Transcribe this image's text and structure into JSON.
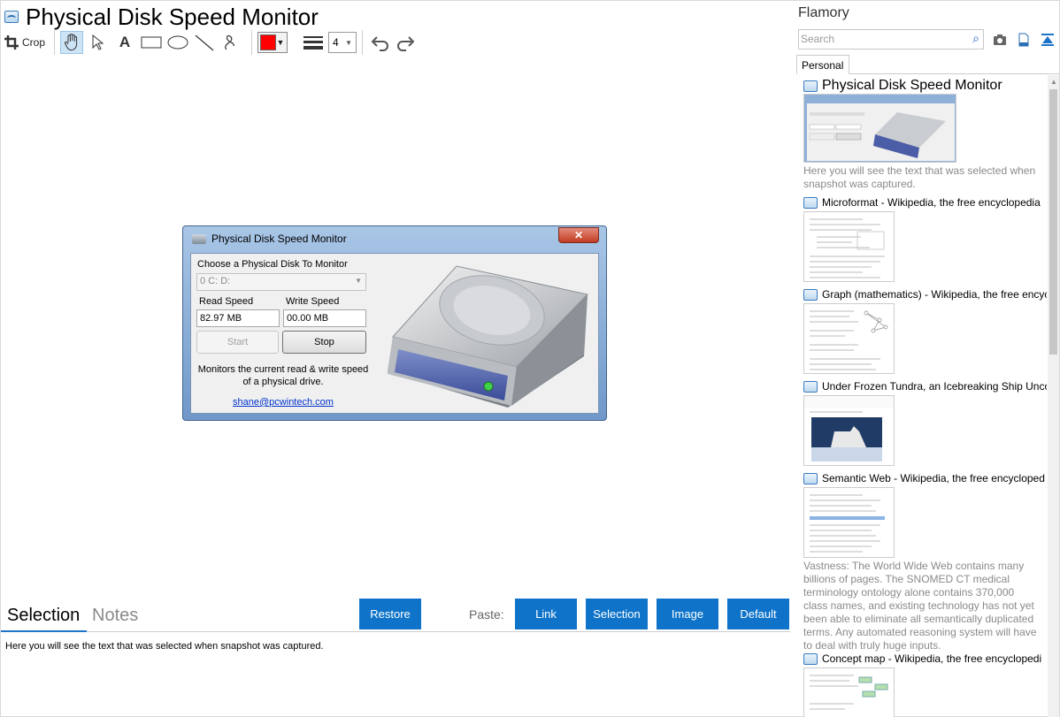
{
  "document": {
    "title": "Physical Disk Speed Monitor"
  },
  "toolbar": {
    "crop_label": "Crop",
    "stroke_width": "4",
    "color": "#ff0000"
  },
  "embedded_window": {
    "title": "Physical Disk Speed Monitor",
    "close_glyph": "✕",
    "choose_label": "Choose a Physical Disk To Monitor",
    "disk_value": "0 C: D:",
    "read_label": "Read Speed",
    "write_label": "Write Speed",
    "read_value": "82.97 MB",
    "write_value": "00.00 MB",
    "start_label": "Start",
    "stop_label": "Stop",
    "description": "Monitors the current read & write speed of a physical drive.",
    "email": "shane@pcwintech.com"
  },
  "bottom": {
    "tab_selection": "Selection",
    "tab_notes": "Notes",
    "restore_label": "Restore",
    "paste_label": "Paste:",
    "paste_buttons": [
      "Link",
      "Selection",
      "Image",
      "Default"
    ],
    "selection_text": "Here you will see the text that was selected when snapshot was captured."
  },
  "sidebar": {
    "app_name": "Flamory",
    "search_placeholder": "Search",
    "tab_personal": "Personal",
    "items": [
      {
        "title": "Physical Disk Speed Monitor",
        "desc": "Here you will see the text that was selected when snapshot was captured."
      },
      {
        "title": "Microformat - Wikipedia, the free encyclopedia"
      },
      {
        "title": "Graph (mathematics) - Wikipedia, the free encyc"
      },
      {
        "title": "Under Frozen Tundra, an Icebreaking Ship Unco"
      },
      {
        "title": "Semantic Web - Wikipedia, the free encycloped",
        "desc": "Vastness: The World Wide Web contains many billions of pages. The SNOMED CT medical terminology ontology alone contains 370,000 class names, and existing technology has not yet been able to eliminate all semantically duplicated terms. Any automated reasoning system will have to deal with truly huge inputs."
      },
      {
        "title": "Concept map - Wikipedia, the free encyclopedi"
      }
    ]
  }
}
